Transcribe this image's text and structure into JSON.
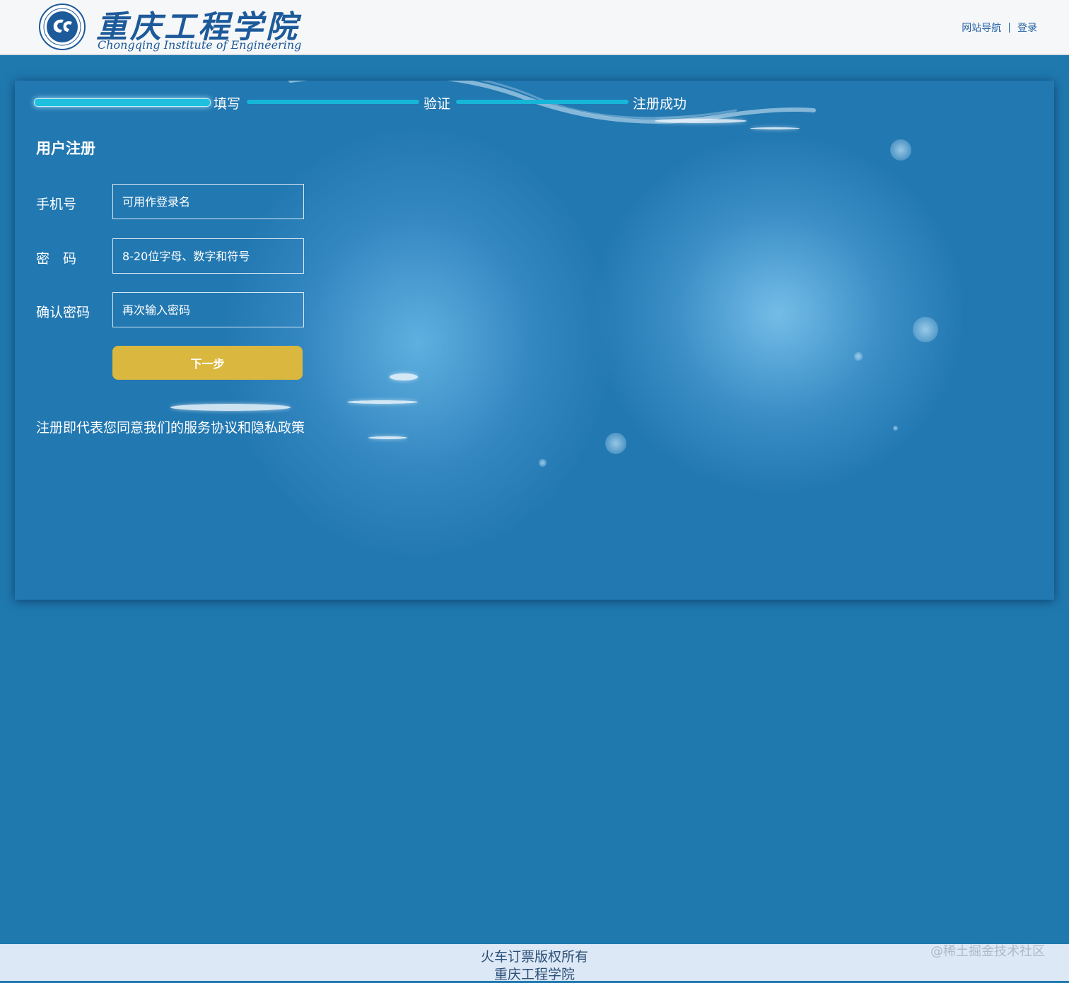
{
  "header": {
    "logo_cn": "重庆工程学院",
    "logo_en": "Chongqing Institute of Engineering",
    "nav": {
      "site_nav": "网站导航",
      "separator": "|",
      "login": "登录"
    }
  },
  "steps": [
    {
      "label": "填写",
      "active": true
    },
    {
      "label": "验证",
      "active": false
    },
    {
      "label": "注册成功",
      "active": false
    }
  ],
  "form": {
    "title": "用户注册",
    "phone": {
      "label": "手机号",
      "placeholder": "可用作登录名",
      "value": ""
    },
    "password": {
      "label": "密　码",
      "placeholder": "8-20位字母、数字和符号",
      "value": ""
    },
    "confirm": {
      "label": "确认密码",
      "placeholder": "再次输入密码",
      "value": ""
    },
    "next_button": "下一步",
    "agreement": "注册即代表您同意我们的服务协议和隐私政策"
  },
  "footer": {
    "line1": "火车订票版权所有",
    "line2": "重庆工程学院"
  },
  "watermark": "@稀土掘金技术社区",
  "colors": {
    "page_bg": "#1f79af",
    "step_bar": "#16b6d8",
    "button": "#dab73e",
    "header_bg": "#f6f7f8",
    "footer_bg": "#dce8f5",
    "brand_blue": "#1d5a9a"
  }
}
